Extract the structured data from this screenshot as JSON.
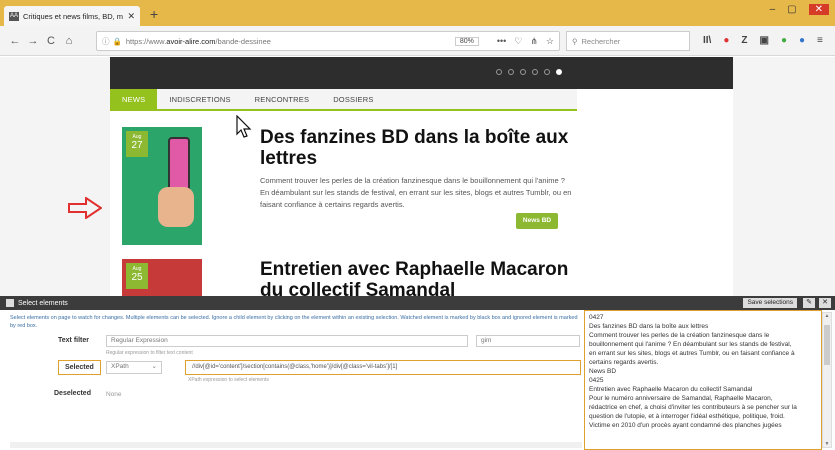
{
  "browser": {
    "tab_title": "Critiques et news films, BD, m...",
    "favicon_text": "AA",
    "tab_close": "✕",
    "new_tab": "+",
    "url_prefix": "https://www.",
    "url_domain": "avoir-alire.com",
    "url_path": "/bande-dessinee",
    "zoom": "80%",
    "search_placeholder": "Rechercher",
    "window_controls": [
      "–",
      "▢",
      "✕"
    ],
    "nav_icons": [
      "←",
      "→",
      "C",
      "⌂"
    ],
    "url_icons": [
      "•••",
      "♡",
      "⋔",
      "☆"
    ],
    "toolbar_icons": [
      "II\\",
      "●",
      "Z",
      "▣",
      "●",
      "●",
      "≡"
    ]
  },
  "site": {
    "menu": [
      {
        "label": "NEWS",
        "active": true
      },
      {
        "label": "INDISCRETIONS",
        "active": false
      },
      {
        "label": "RENCONTRES",
        "active": false
      },
      {
        "label": "DOSSIERS",
        "active": false
      }
    ],
    "carousel_dots": 6,
    "active_dot": 5,
    "articles": [
      {
        "month": "Aug",
        "day": "27",
        "title": "Des fanzines BD dans la boîte aux lettres",
        "description": "Comment trouver les perles de la création fanzinesque dans le bouillonnement qui l'anime ? En déambulant sur les stands de festival, en errant sur les sites, blogs et autres Tumblr, ou en faisant confiance à certains regards avertis.",
        "tag": "News BD"
      },
      {
        "month": "Aug",
        "day": "25",
        "title": "Entretien avec Raphaelle Macaron du collectif Samandal"
      }
    ]
  },
  "panel": {
    "header_title": "Select elements",
    "save_label": "Save selections",
    "edit_icon": "✎",
    "close_icon": "✕",
    "instructions": "Select elements on page to watch for changes. Multiple elements can be selected. Ignore a child element by clicking on the element within an existing selection. Watched element is marked by black box and ignored element is marked by red box.",
    "text_filter_label": "Text filter",
    "text_filter_value": "Regular Expression",
    "text_filter_flags": "gim",
    "text_filter_hint": "Regular expression to filter text content",
    "selected_label": "Selected",
    "selector_type": "XPath",
    "selector_value": "//div[@id='content']/section[contains(@class,'home')]/div[@class='vil-tabs']/[1]",
    "selector_hint": "XPath expression to select elements",
    "deselected_label": "Deselected",
    "deselected_value": "None",
    "output_lines": [
      "0427",
      "Des fanzines BD dans la boîte aux lettres",
      "Comment trouver les perles de la création fanzinesque dans le",
      "bouillonnement qui l'anime ? En déambulant sur les stands de festival,",
      "en errant sur les sites, blogs et autres Tumblr, ou en faisant confiance à",
      "certains regards avertis.",
      "News BD",
      "0425",
      "Entretien avec Raphaelle Macaron du collectif Samandal",
      "Pour le numéro anniversaire de Samandal, Raphaelle Macaron,",
      "rédactrice en chef, a choisi d'inviter les contributeurs à se pencher sur la",
      "question de l'utopie, et à interroger l'idéal esthétique, politique, froid.",
      "Victime en 2010 d'un procès ayant condamné des planches jugées"
    ]
  },
  "colors": {
    "titlebar": "#e6b84a",
    "accent_green": "#95c11f",
    "panel_header": "#3c3c3c",
    "highlight_orange": "#e0a030",
    "arrow_red": "#e03030"
  }
}
